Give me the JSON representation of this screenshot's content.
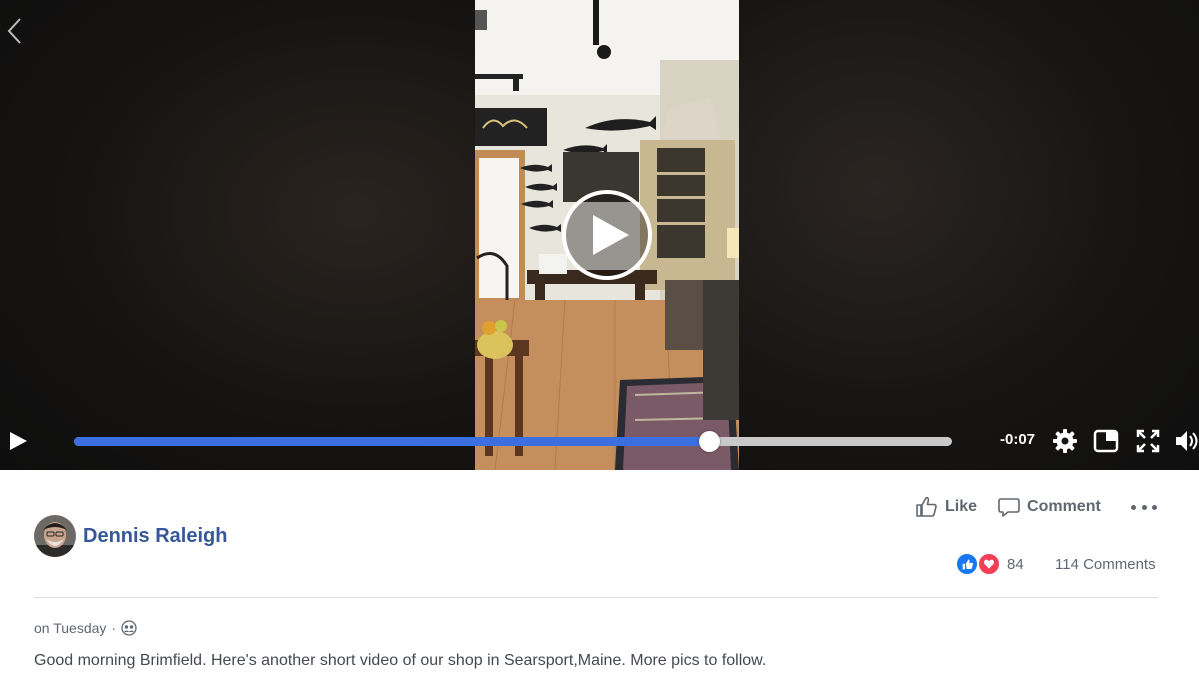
{
  "player": {
    "time_remaining": "-0:07",
    "progress": 0.723,
    "icons": {
      "back": "chevron-left-icon",
      "play_overlay": "play-circle-icon",
      "play": "play-icon",
      "settings": "gear-icon",
      "picture_in_picture": "pip-icon",
      "fullscreen": "fullscreen-icon",
      "volume": "volume-icon"
    },
    "colors": {
      "progress": "#3b6fe0",
      "track": "#c9c9c9"
    }
  },
  "post": {
    "author_name": "Dennis Raleigh",
    "like_label": "Like",
    "comment_label": "Comment",
    "reaction_count": "84",
    "comments_count": "114 Comments",
    "timestamp": "on Tuesday",
    "separator": "·",
    "audience_icon": "friends-icon",
    "text": "Good morning Brimfield. Here's another short video of our shop in Searsport,Maine. More pics to follow.",
    "colors": {
      "author": "#365899",
      "like_reaction": "#1877f2",
      "love_reaction": "#f33e58"
    }
  }
}
